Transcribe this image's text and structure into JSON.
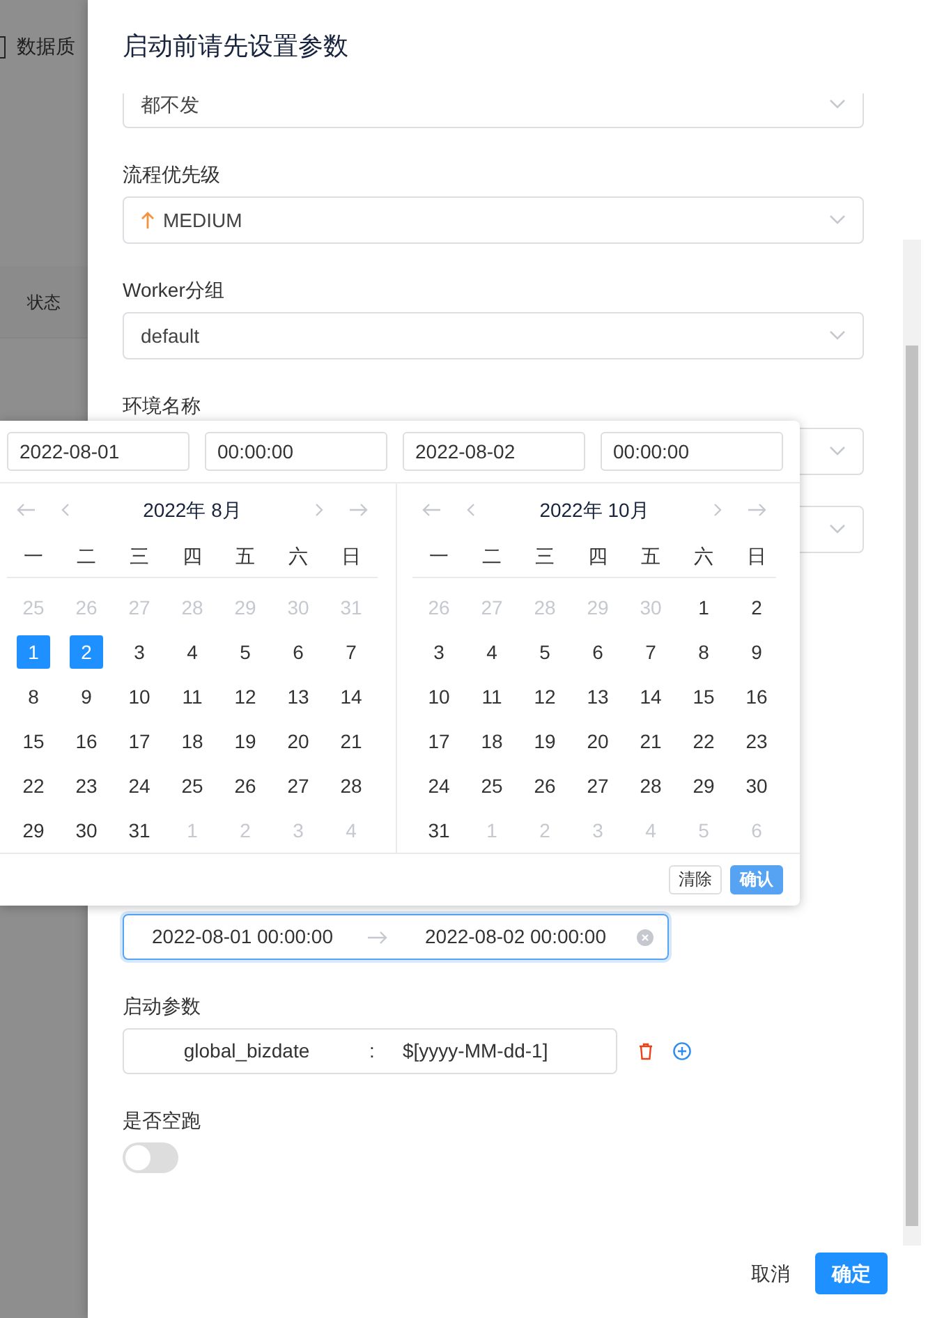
{
  "background": {
    "breadcrumb": "数据质",
    "column_header": "状态"
  },
  "drawer": {
    "title": "启动前请先设置参数",
    "fields": [
      {
        "kind": "select",
        "value": "都不发"
      },
      {
        "kind": "priority-select",
        "label": "流程优先级",
        "value": "MEDIUM"
      },
      {
        "kind": "select",
        "label": "Worker分组",
        "value": "default"
      },
      {
        "kind": "select",
        "label": "环境名称"
      },
      {
        "kind": "select"
      },
      {
        "kind": "daterange",
        "start": "2022-08-01 00:00:00",
        "end": "2022-08-02 00:00:00",
        "focused": true
      },
      {
        "kind": "params",
        "label": "启动参数",
        "key": "global_bizdate",
        "separator": ":",
        "value": "$[yyyy-MM-dd-1]"
      },
      {
        "kind": "switch",
        "label": "是否空跑",
        "on": false
      }
    ],
    "buttons": [
      {
        "label": "取消",
        "primary": false
      },
      {
        "label": "确定",
        "primary": true
      }
    ]
  },
  "date_popup": {
    "inputs": [
      "2022-08-01",
      "00:00:00",
      "2022-08-02",
      "00:00:00"
    ],
    "panels": [
      {
        "title": "2022年 8月",
        "weekdays": [
          "一",
          "二",
          "三",
          "四",
          "五",
          "六",
          "日"
        ],
        "days": [
          {
            "label": "25",
            "muted": true,
            "selected": false
          },
          {
            "label": "26",
            "muted": true,
            "selected": false
          },
          {
            "label": "27",
            "muted": true,
            "selected": false
          },
          {
            "label": "28",
            "muted": true,
            "selected": false
          },
          {
            "label": "29",
            "muted": true,
            "selected": false
          },
          {
            "label": "30",
            "muted": true,
            "selected": false
          },
          {
            "label": "31",
            "muted": true,
            "selected": false
          },
          {
            "label": "1",
            "muted": false,
            "selected": true
          },
          {
            "label": "2",
            "muted": false,
            "selected": true
          },
          {
            "label": "3",
            "muted": false,
            "selected": false
          },
          {
            "label": "4",
            "muted": false,
            "selected": false
          },
          {
            "label": "5",
            "muted": false,
            "selected": false
          },
          {
            "label": "6",
            "muted": false,
            "selected": false
          },
          {
            "label": "7",
            "muted": false,
            "selected": false
          },
          {
            "label": "8",
            "muted": false,
            "selected": false
          },
          {
            "label": "9",
            "muted": false,
            "selected": false
          },
          {
            "label": "10",
            "muted": false,
            "selected": false
          },
          {
            "label": "11",
            "muted": false,
            "selected": false
          },
          {
            "label": "12",
            "muted": false,
            "selected": false
          },
          {
            "label": "13",
            "muted": false,
            "selected": false
          },
          {
            "label": "14",
            "muted": false,
            "selected": false
          },
          {
            "label": "15",
            "muted": false,
            "selected": false
          },
          {
            "label": "16",
            "muted": false,
            "selected": false
          },
          {
            "label": "17",
            "muted": false,
            "selected": false
          },
          {
            "label": "18",
            "muted": false,
            "selected": false
          },
          {
            "label": "19",
            "muted": false,
            "selected": false
          },
          {
            "label": "20",
            "muted": false,
            "selected": false
          },
          {
            "label": "21",
            "muted": false,
            "selected": false
          },
          {
            "label": "22",
            "muted": false,
            "selected": false
          },
          {
            "label": "23",
            "muted": false,
            "selected": false
          },
          {
            "label": "24",
            "muted": false,
            "selected": false
          },
          {
            "label": "25",
            "muted": false,
            "selected": false
          },
          {
            "label": "26",
            "muted": false,
            "selected": false
          },
          {
            "label": "27",
            "muted": false,
            "selected": false
          },
          {
            "label": "28",
            "muted": false,
            "selected": false
          },
          {
            "label": "29",
            "muted": false,
            "selected": false
          },
          {
            "label": "30",
            "muted": false,
            "selected": false
          },
          {
            "label": "31",
            "muted": false,
            "selected": false
          },
          {
            "label": "1",
            "muted": true,
            "selected": false
          },
          {
            "label": "2",
            "muted": true,
            "selected": false
          },
          {
            "label": "3",
            "muted": true,
            "selected": false
          },
          {
            "label": "4",
            "muted": true,
            "selected": false
          }
        ]
      },
      {
        "title": "2022年 10月",
        "weekdays": [
          "一",
          "二",
          "三",
          "四",
          "五",
          "六",
          "日"
        ],
        "days": [
          {
            "label": "26",
            "muted": true,
            "selected": false
          },
          {
            "label": "27",
            "muted": true,
            "selected": false
          },
          {
            "label": "28",
            "muted": true,
            "selected": false
          },
          {
            "label": "29",
            "muted": true,
            "selected": false
          },
          {
            "label": "30",
            "muted": true,
            "selected": false
          },
          {
            "label": "1",
            "muted": false,
            "selected": false
          },
          {
            "label": "2",
            "muted": false,
            "selected": false
          },
          {
            "label": "3",
            "muted": false,
            "selected": false
          },
          {
            "label": "4",
            "muted": false,
            "selected": false
          },
          {
            "label": "5",
            "muted": false,
            "selected": false
          },
          {
            "label": "6",
            "muted": false,
            "selected": false
          },
          {
            "label": "7",
            "muted": false,
            "selected": false
          },
          {
            "label": "8",
            "muted": false,
            "selected": false
          },
          {
            "label": "9",
            "muted": false,
            "selected": false
          },
          {
            "label": "10",
            "muted": false,
            "selected": false
          },
          {
            "label": "11",
            "muted": false,
            "selected": false
          },
          {
            "label": "12",
            "muted": false,
            "selected": false
          },
          {
            "label": "13",
            "muted": false,
            "selected": false
          },
          {
            "label": "14",
            "muted": false,
            "selected": false
          },
          {
            "label": "15",
            "muted": false,
            "selected": false
          },
          {
            "label": "16",
            "muted": false,
            "selected": false
          },
          {
            "label": "17",
            "muted": false,
            "selected": false
          },
          {
            "label": "18",
            "muted": false,
            "selected": false
          },
          {
            "label": "19",
            "muted": false,
            "selected": false
          },
          {
            "label": "20",
            "muted": false,
            "selected": false
          },
          {
            "label": "21",
            "muted": false,
            "selected": false
          },
          {
            "label": "22",
            "muted": false,
            "selected": false
          },
          {
            "label": "23",
            "muted": false,
            "selected": false
          },
          {
            "label": "24",
            "muted": false,
            "selected": false
          },
          {
            "label": "25",
            "muted": false,
            "selected": false
          },
          {
            "label": "26",
            "muted": false,
            "selected": false
          },
          {
            "label": "27",
            "muted": false,
            "selected": false
          },
          {
            "label": "28",
            "muted": false,
            "selected": false
          },
          {
            "label": "29",
            "muted": false,
            "selected": false
          },
          {
            "label": "30",
            "muted": false,
            "selected": false
          },
          {
            "label": "31",
            "muted": false,
            "selected": false
          },
          {
            "label": "1",
            "muted": true,
            "selected": false
          },
          {
            "label": "2",
            "muted": true,
            "selected": false
          },
          {
            "label": "3",
            "muted": true,
            "selected": false
          },
          {
            "label": "4",
            "muted": true,
            "selected": false
          },
          {
            "label": "5",
            "muted": true,
            "selected": false
          },
          {
            "label": "6",
            "muted": true,
            "selected": false
          }
        ]
      }
    ],
    "buttons": [
      {
        "label": "清除",
        "primary": false
      },
      {
        "label": "确认",
        "primary": true
      }
    ]
  }
}
